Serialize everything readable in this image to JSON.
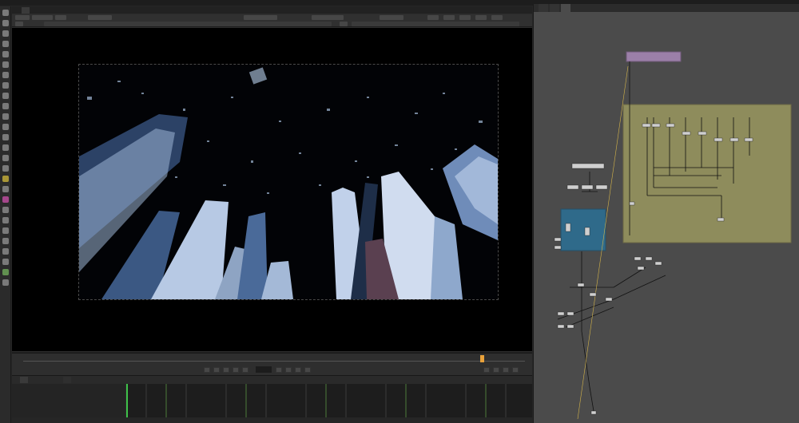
{
  "menu": {
    "items": [
      "",
      "",
      "",
      "",
      "",
      "",
      "",
      "",
      ""
    ]
  },
  "viewer": {
    "tab_label": "",
    "frame_current": "",
    "frame_start": "",
    "format_label": "",
    "info_text": "",
    "colors": {
      "viewport": "#000000",
      "sky": "#020306",
      "building_light": "#c8d8ee",
      "building_dark": "#1b2a44"
    }
  },
  "timeline": {
    "cursor_color": "#e8a13a"
  },
  "dope_sheet": {
    "tab1": "",
    "tab2": "",
    "playhead_color": "#3ec14a"
  },
  "right_panel": {
    "tabs": [
      {
        "label": ""
      },
      {
        "label": ""
      },
      {
        "label": ""
      }
    ],
    "colors": {
      "graph_bg": "#4b4b4b",
      "backdrop_yellow": "#8e8c5c",
      "backdrop_blue": "#2f6a8a",
      "node_purple": "#9b7fa8",
      "wire": "#121212"
    }
  },
  "status": {
    "bottom_text": ""
  }
}
